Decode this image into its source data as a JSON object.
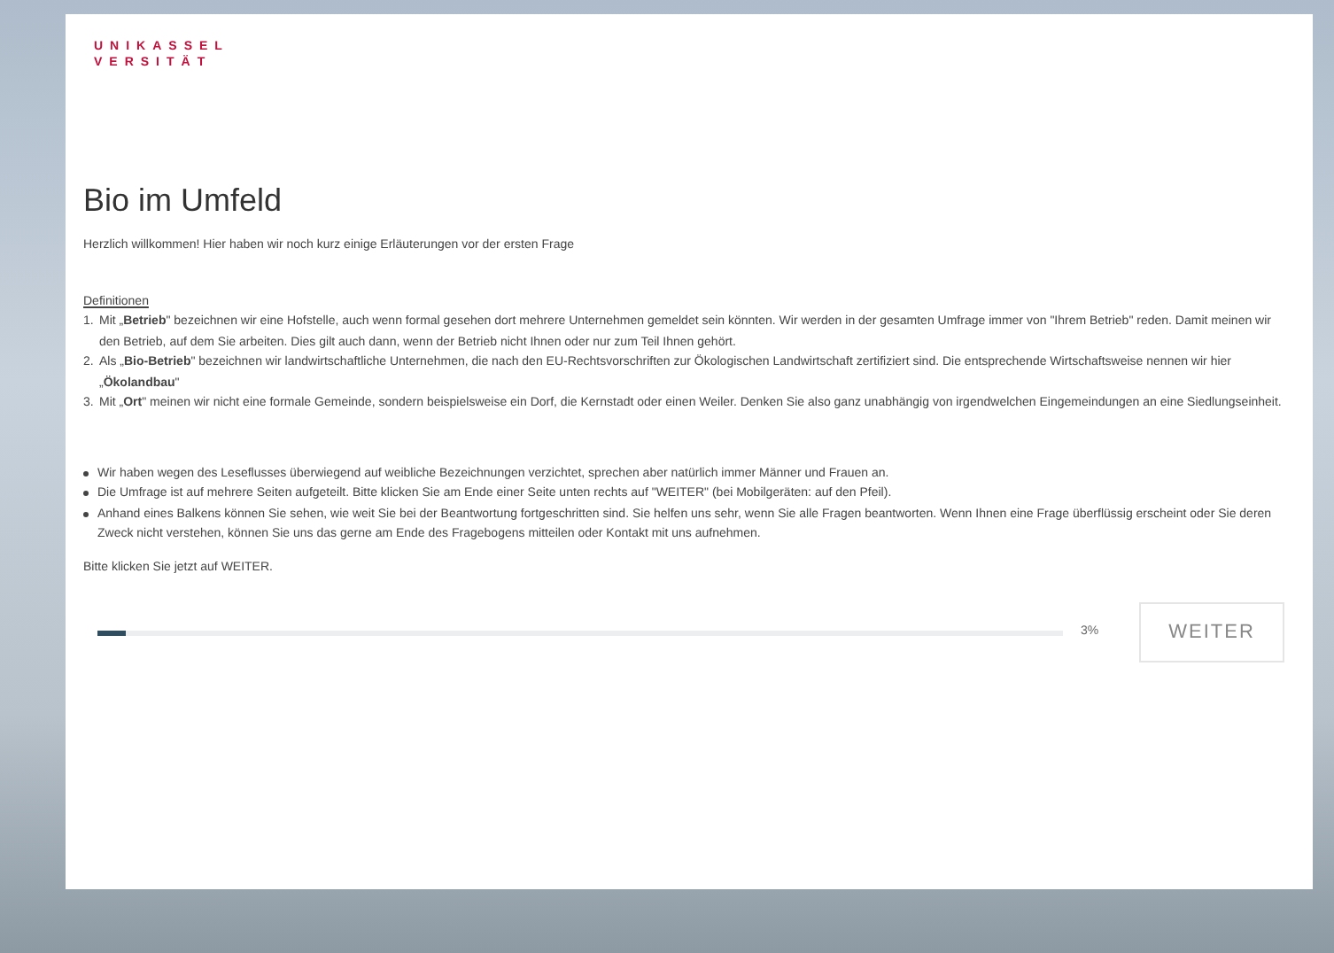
{
  "logo": {
    "line_1": "UNIKASSEL",
    "line_2": "VERSITÄT"
  },
  "title": "Bio im Umfeld",
  "intro": "Herzlich willkommen! Hier haben wir noch kurz einige Erläuterungen vor der ersten Frage",
  "definitions": {
    "heading": "Definitionen",
    "items": [
      {
        "number": "1.",
        "text": "Mit „**Betrieb**\" bezeichnen wir eine Hofstelle, auch wenn formal gesehen dort mehrere Unternehmen gemeldet sein könnten. Wir werden in der gesamten Umfrage immer von \"Ihrem Betrieb\" reden. Damit meinen wir den Betrieb, auf dem Sie arbeiten. Dies gilt auch dann, wenn der Betrieb nicht Ihnen oder nur zum Teil Ihnen gehört."
      },
      {
        "number": "2.",
        "text": "Als „**Bio-Betrieb**\" bezeichnen wir landwirtschaftliche Unternehmen, die nach den EU-Rechtsvorschriften zur Ökologischen Landwirtschaft zertifiziert sind. Die entsprechende Wirtschaftsweise nennen wir hier „**Ökolandbau**\""
      },
      {
        "number": "3.",
        "text": "Mit „**Ort**\" meinen wir nicht eine formale Gemeinde, sondern beispielsweise ein Dorf, die Kernstadt oder einen Weiler. Denken Sie also ganz unabhängig von irgendwelchen Eingemeindungen an eine Siedlungseinheit."
      }
    ]
  },
  "notes": [
    "Wir haben wegen des Leseflusses überwiegend auf weibliche Bezeichnungen verzichtet, sprechen aber natürlich immer Männer und Frauen an.",
    "Die Umfrage ist auf mehrere Seiten aufgeteilt. Bitte klicken Sie am Ende einer Seite unten rechts auf \"WEITER\" (bei Mobilgeräten: auf den Pfeil).",
    "Anhand eines Balkens können Sie sehen, wie weit Sie bei der Beantwortung fortgeschritten sind. Sie helfen uns sehr, wenn Sie alle Fragen beantworten. Wenn Ihnen eine Frage überflüssig erscheint oder Sie deren Zweck nicht verstehen, können Sie uns das gerne am Ende des Fragebogens mitteilen oder Kontakt mit uns aufnehmen."
  ],
  "instruction": "Bitte klicken Sie jetzt auf WEITER.",
  "progress": {
    "level": 0.03,
    "reading": "3%"
  },
  "next_button": "WEITER"
}
